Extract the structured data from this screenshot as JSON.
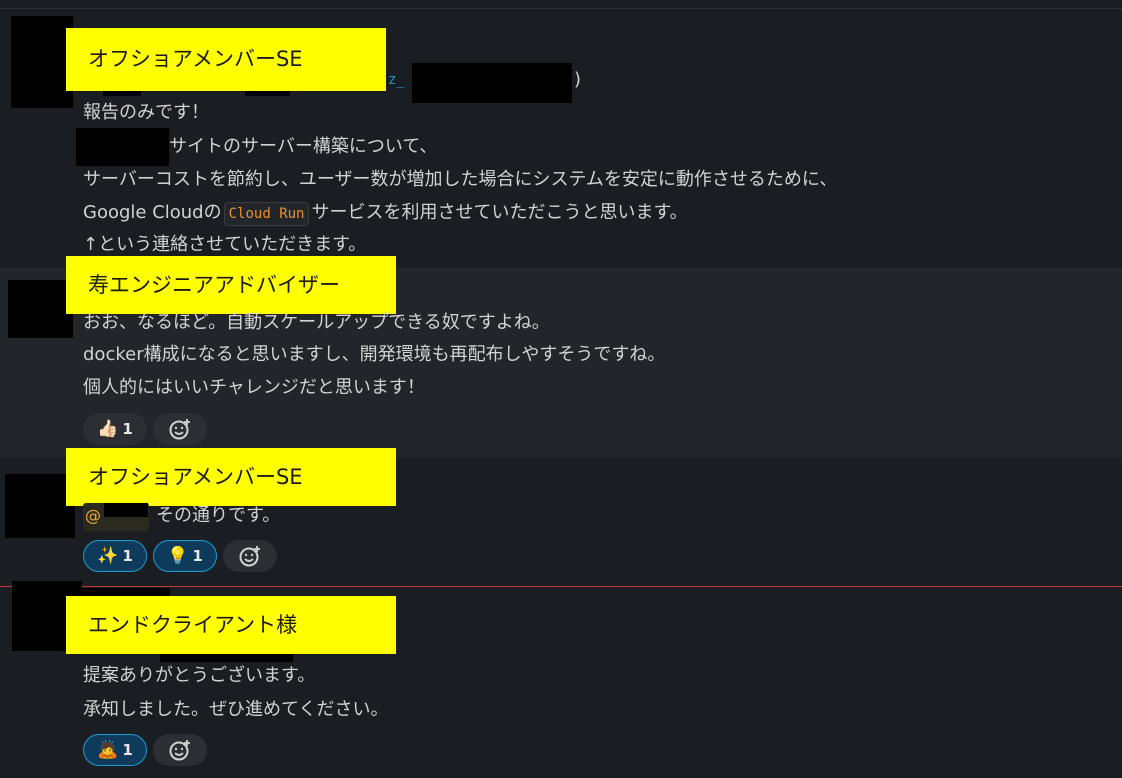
{
  "messages": [
    {
      "label": "オフショアメンバーSE",
      "header_fragment": "z_",
      "header_paren": ")",
      "lines": [
        "報告のみです！",
        "サイトのサーバー構築について、",
        "サーバーコストを節約し、ユーザー数が増加した場合にシステムを安定に動作させるために、",
        "↑という連絡させていただきます。"
      ],
      "line3_prefix": "Google Cloudの",
      "line3_code": "Cloud Run",
      "line3_suffix": "サービスを利用させていただこうと思います。"
    },
    {
      "label": "寿エンジニアアドバイザー",
      "lines": [
        "おお、なるほど。自動スケールアップできる奴ですよね。",
        "docker構成になると思いますし、開発環境も再配布しやすそうですね。",
        "個人的にはいいチャレンジだと思います！"
      ],
      "reactions": [
        {
          "emoji": "👍🏻",
          "emoji_name": "thumbs-up-light",
          "count": "1",
          "active": false
        }
      ]
    },
    {
      "label": "オフショアメンバーSE",
      "mention_at": "@",
      "text": "その通りです。",
      "reactions": [
        {
          "emoji": "✨",
          "emoji_name": "sparkles",
          "count": "1",
          "active": true
        },
        {
          "emoji": "💡",
          "emoji_name": "light-bulb",
          "count": "1",
          "active": true
        }
      ]
    },
    {
      "label": "エンドクライアント様",
      "lines": [
        "提案ありがとうございます。",
        "承知しました。ぜひ進めてください。"
      ],
      "reactions": [
        {
          "emoji": "🙇",
          "emoji_name": "bowing-person",
          "count": "1",
          "active": true
        }
      ]
    }
  ],
  "colors": {
    "background": "#1a1d21",
    "hover_row": "#222529",
    "label_bg": "#ffff00",
    "code_text": "#e8912d",
    "active_reaction_border": "#1d9bd1",
    "new_divider": "#c0392b"
  },
  "icons": {
    "add_reaction": "add-emoji-reaction-icon"
  }
}
